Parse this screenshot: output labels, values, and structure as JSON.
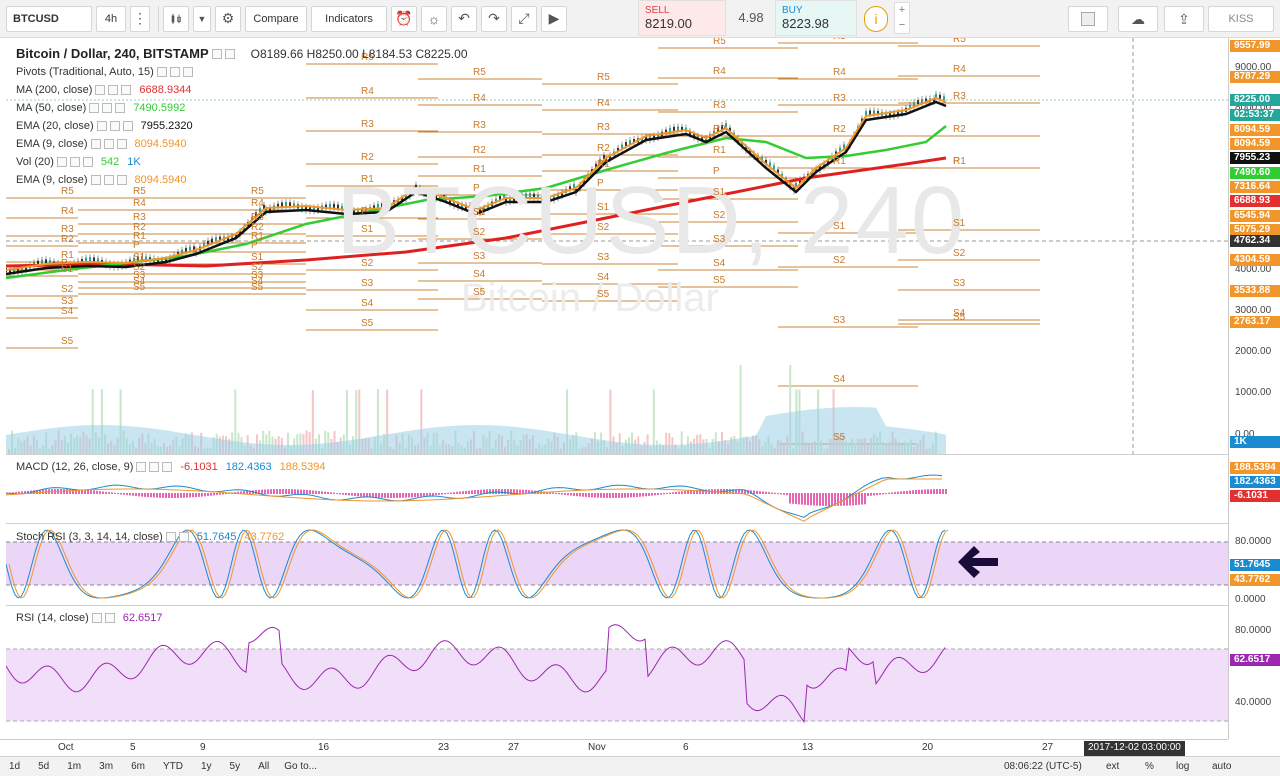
{
  "toolbar": {
    "symbol": "BTCUSD",
    "interval": "4h",
    "compare": "Compare",
    "indicators": "Indicators",
    "sell_label": "SELL",
    "sell_price": "8219.00",
    "spread": "4.98",
    "buy_label": "BUY",
    "buy_price": "8223.98",
    "kiss": "KISS"
  },
  "legend": {
    "title": "Bitcoin / Dollar, 240, BITSTAMP",
    "ohlc": "O8189.66  H8250.00  L8184.53  C8225.00",
    "rows": [
      {
        "name": "Pivots (Traditional, Auto, 15)",
        "value": "",
        "color": "#333333"
      },
      {
        "name": "MA (200, close)",
        "value": "6688.9344",
        "color": "#e03030"
      },
      {
        "name": "MA (50, close)",
        "value": "7490.5992",
        "color": "#33cc33"
      },
      {
        "name": "EMA (20, close)",
        "value": "7955.2320",
        "color": "#111111"
      },
      {
        "name": "EMA (9, close)",
        "value": "8094.5940",
        "color": "#f0962a"
      },
      {
        "name": "Vol (20)",
        "value": "542",
        "value2": "1K",
        "color": "#33cc33",
        "color2": "#1a8bd0"
      },
      {
        "name": "EMA (9, close)",
        "value": "8094.5940",
        "color": "#f0962a"
      }
    ]
  },
  "watermark": {
    "main": "BTCUSD, 240",
    "sub": "Bitcoin / Dollar"
  },
  "price_axis": {
    "ticks": [
      "9000.00",
      "8000.00",
      "7000.00",
      "6000.00",
      "5000.00",
      "4000.00",
      "3000.00",
      "2000.00",
      "1000.00",
      "0.00"
    ],
    "tags": [
      {
        "text": "9557.99",
        "color": "#f0962a"
      },
      {
        "text": "8787.29",
        "color": "#f0962a"
      },
      {
        "text": "8225.00",
        "color": "#26a69a"
      },
      {
        "text": "02:53:37",
        "color": "#26a69a"
      },
      {
        "text": "8094.59",
        "color": "#f0962a"
      },
      {
        "text": "8094.59",
        "color": "#f0962a"
      },
      {
        "text": "7955.23",
        "color": "#111111"
      },
      {
        "text": "7490.60",
        "color": "#33cc33"
      },
      {
        "text": "7316.64",
        "color": "#f0962a"
      },
      {
        "text": "6688.93",
        "color": "#e03030"
      },
      {
        "text": "6545.94",
        "color": "#f0962a"
      },
      {
        "text": "5075.29",
        "color": "#f0962a"
      },
      {
        "text": "4762.34",
        "color": "#333333"
      },
      {
        "text": "4304.59",
        "color": "#f0962a"
      },
      {
        "text": "3533.88",
        "color": "#f0962a"
      },
      {
        "text": "2763.17",
        "color": "#f0962a"
      },
      {
        "text": "1K",
        "color": "#1a8bd0"
      }
    ]
  },
  "macd": {
    "name": "MACD (12, 26, close, 9)",
    "v1": "-6.1031",
    "v2": "182.4363",
    "v3": "188.5394",
    "tags": [
      {
        "text": "188.5394",
        "color": "#f0962a"
      },
      {
        "text": "182.4363",
        "color": "#1a8bd0"
      },
      {
        "text": "-6.1031",
        "color": "#e03030"
      }
    ]
  },
  "stoch": {
    "name": "Stoch RSI (3, 3, 14, 14, close)",
    "v1": "51.7645",
    "v2": "43.7762",
    "ticks": [
      "80.0000",
      "0.0000"
    ],
    "tags": [
      {
        "text": "51.7645",
        "color": "#1a8bd0"
      },
      {
        "text": "43.7762",
        "color": "#f0962a"
      }
    ]
  },
  "rsi": {
    "name": "RSI (14, close)",
    "value": "62.6517",
    "ticks": [
      "80.0000",
      "40.0000"
    ],
    "tag": {
      "text": "62.6517",
      "color": "#9c27b0"
    }
  },
  "pivot_labels": [
    "R5",
    "R4",
    "R3",
    "R2",
    "R1",
    "P",
    "S1",
    "S2",
    "S3",
    "S4",
    "S5"
  ],
  "time_axis": {
    "labels": [
      "Oct",
      "5",
      "9",
      "16",
      "23",
      "27",
      "Nov",
      "6",
      "13",
      "20",
      "27"
    ],
    "cursor": "2017-12-02 03:00:00"
  },
  "bottom": {
    "ranges": [
      "1d",
      "5d",
      "1m",
      "3m",
      "6m",
      "YTD",
      "1y",
      "5y",
      "All"
    ],
    "goto": "Go to...",
    "clock": "08:06:22 (UTC-5)",
    "ext": "ext",
    "pct": "%",
    "log": "log",
    "auto": "auto"
  }
}
